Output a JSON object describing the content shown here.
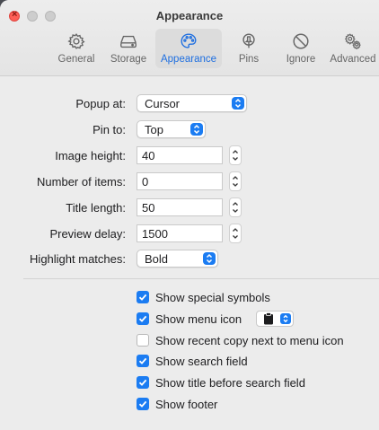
{
  "window": {
    "title": "Appearance"
  },
  "toolbar": {
    "items": [
      {
        "label": "General",
        "icon": "gear-icon"
      },
      {
        "label": "Storage",
        "icon": "drive-icon"
      },
      {
        "label": "Appearance",
        "icon": "palette-icon",
        "active": true
      },
      {
        "label": "Pins",
        "icon": "pin-icon"
      },
      {
        "label": "Ignore",
        "icon": "prohibit-icon"
      },
      {
        "label": "Advanced",
        "icon": "gears-icon"
      }
    ]
  },
  "settings": {
    "popup_at": {
      "label": "Popup at:",
      "value": "Cursor"
    },
    "pin_to": {
      "label": "Pin to:",
      "value": "Top"
    },
    "image_height": {
      "label": "Image height:",
      "value": "40"
    },
    "number_of_items": {
      "label": "Number of items:",
      "value": "0"
    },
    "title_length": {
      "label": "Title length:",
      "value": "50"
    },
    "preview_delay": {
      "label": "Preview delay:",
      "value": "1500"
    },
    "highlight_matches": {
      "label": "Highlight matches:",
      "value": "Bold"
    }
  },
  "checkboxes": [
    {
      "label": "Show special symbols",
      "checked": true
    },
    {
      "label": "Show menu icon",
      "checked": true
    },
    {
      "label": "Show recent copy next to menu icon",
      "checked": false
    },
    {
      "label": "Show search field",
      "checked": true
    },
    {
      "label": "Show title before search field",
      "checked": true
    },
    {
      "label": "Show footer",
      "checked": true
    }
  ],
  "menu_icon_popup": {
    "icon": "clipboard-icon"
  },
  "colors": {
    "accent": "#1b7cf2",
    "active_tab": "#1f6fe0"
  }
}
